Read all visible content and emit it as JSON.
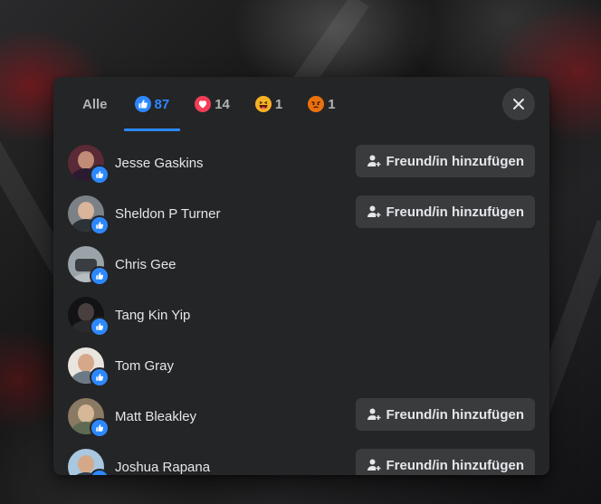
{
  "tabs": [
    {
      "label": "Alle",
      "count": "",
      "icon": "",
      "active": false
    },
    {
      "label": "",
      "count": "87",
      "icon": "like-icon",
      "active": true
    },
    {
      "label": "",
      "count": "14",
      "icon": "love-icon",
      "active": false
    },
    {
      "label": "",
      "count": "1",
      "icon": "haha-icon",
      "active": false
    },
    {
      "label": "",
      "count": "1",
      "icon": "angry-icon",
      "active": false
    }
  ],
  "colors": {
    "accent": "#2d88ff",
    "dialog_bg": "#242526",
    "button_bg": "#3a3b3c",
    "text": "#e4e6eb",
    "muted": "#b0b3b8",
    "love": "#f33e58",
    "haha": "#f7b125",
    "angry": "#e9710f"
  },
  "close_icon": "close-icon",
  "people": [
    {
      "name": "Jesse Gaskins",
      "reaction": "like",
      "button": "Freund/in hinzufügen"
    },
    {
      "name": "Sheldon P Turner",
      "reaction": "like",
      "button": "Freund/in hinzufügen"
    },
    {
      "name": "Chris Gee",
      "reaction": "like",
      "button": ""
    },
    {
      "name": "Tang Kin Yip",
      "reaction": "like",
      "button": ""
    },
    {
      "name": "Tom Gray",
      "reaction": "like",
      "button": ""
    },
    {
      "name": "Matt Bleakley",
      "reaction": "like",
      "button": "Freund/in hinzufügen"
    },
    {
      "name": "Joshua Rapana",
      "reaction": "like",
      "button": "Freund/in hinzufügen"
    }
  ]
}
